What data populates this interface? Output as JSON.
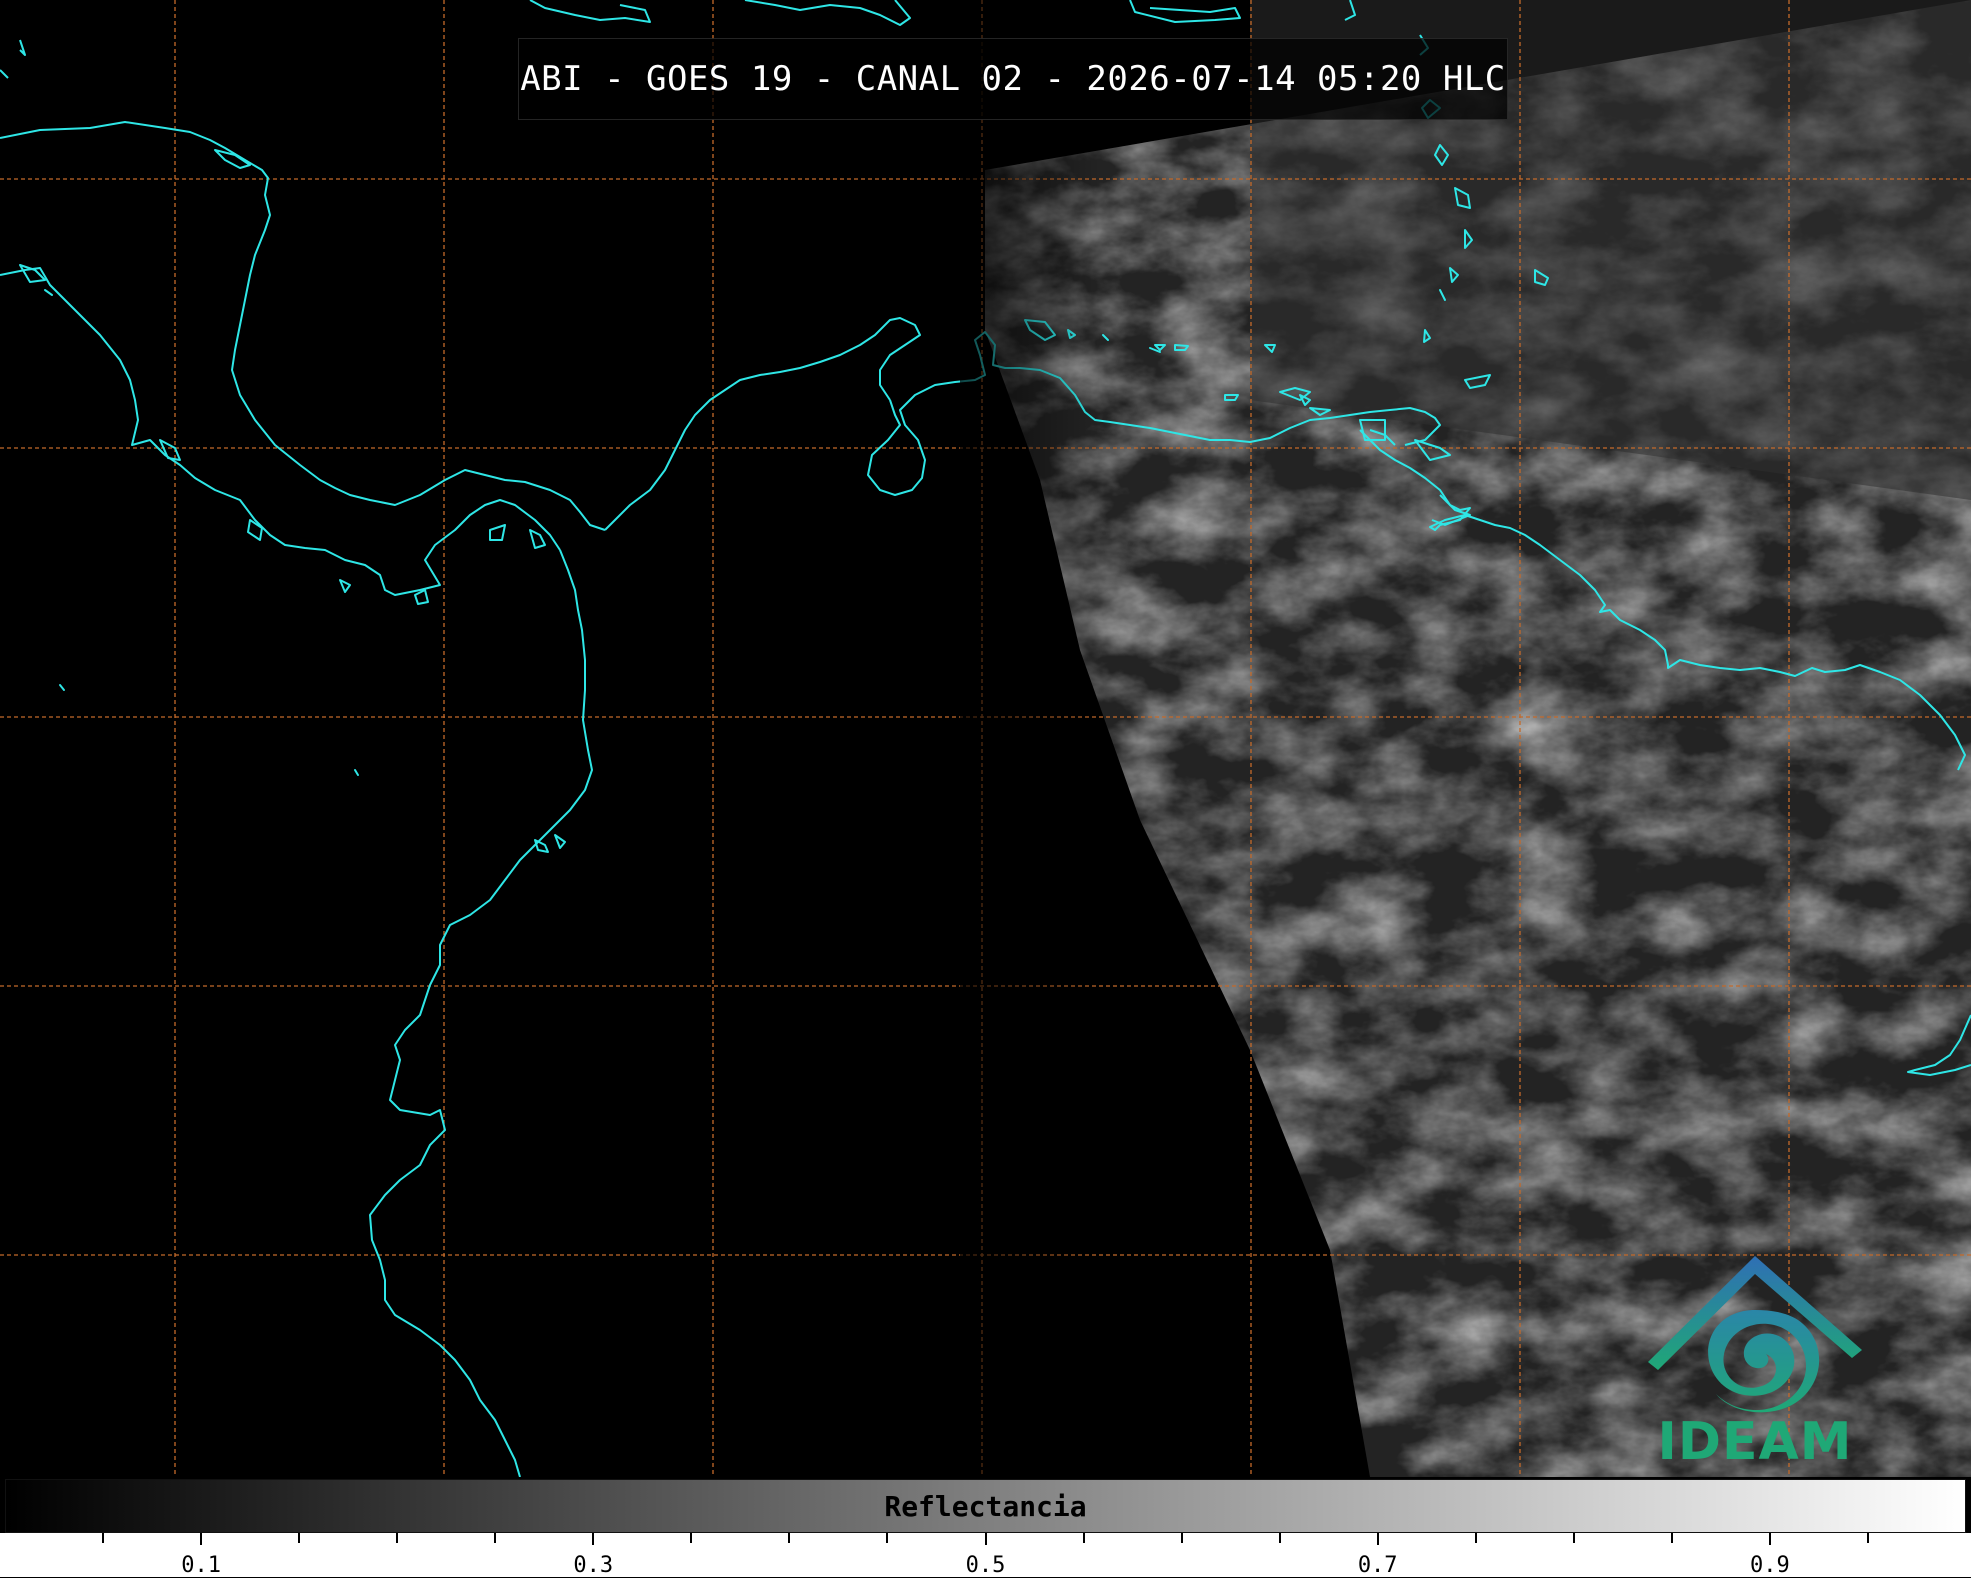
{
  "title": "ABI - GOES 19 - CANAL 02 - 2026-07-14 05:20 HLC",
  "logo": {
    "icon": "ideam-logo-icon",
    "text": "IDEAM",
    "color_teal": "#1fa876",
    "color_blue": "#2f6fb5"
  },
  "map": {
    "coastline_color": "#2ee6e6",
    "grid_color": "#c46a2a",
    "dark_region_color": "#000000",
    "cloud_region_color": "#2a2a2a"
  },
  "colorbar": {
    "label": "Reflectancia",
    "range": [
      0.0,
      1.0
    ],
    "major_ticks": [
      {
        "value": 0.1,
        "label": "0.1"
      },
      {
        "value": 0.3,
        "label": "0.3"
      },
      {
        "value": 0.5,
        "label": "0.5"
      },
      {
        "value": 0.7,
        "label": "0.7"
      },
      {
        "value": 0.9,
        "label": "0.9"
      }
    ],
    "minor_tick_step": 0.05,
    "color_low": "#000000",
    "color_high": "#ffffff"
  }
}
